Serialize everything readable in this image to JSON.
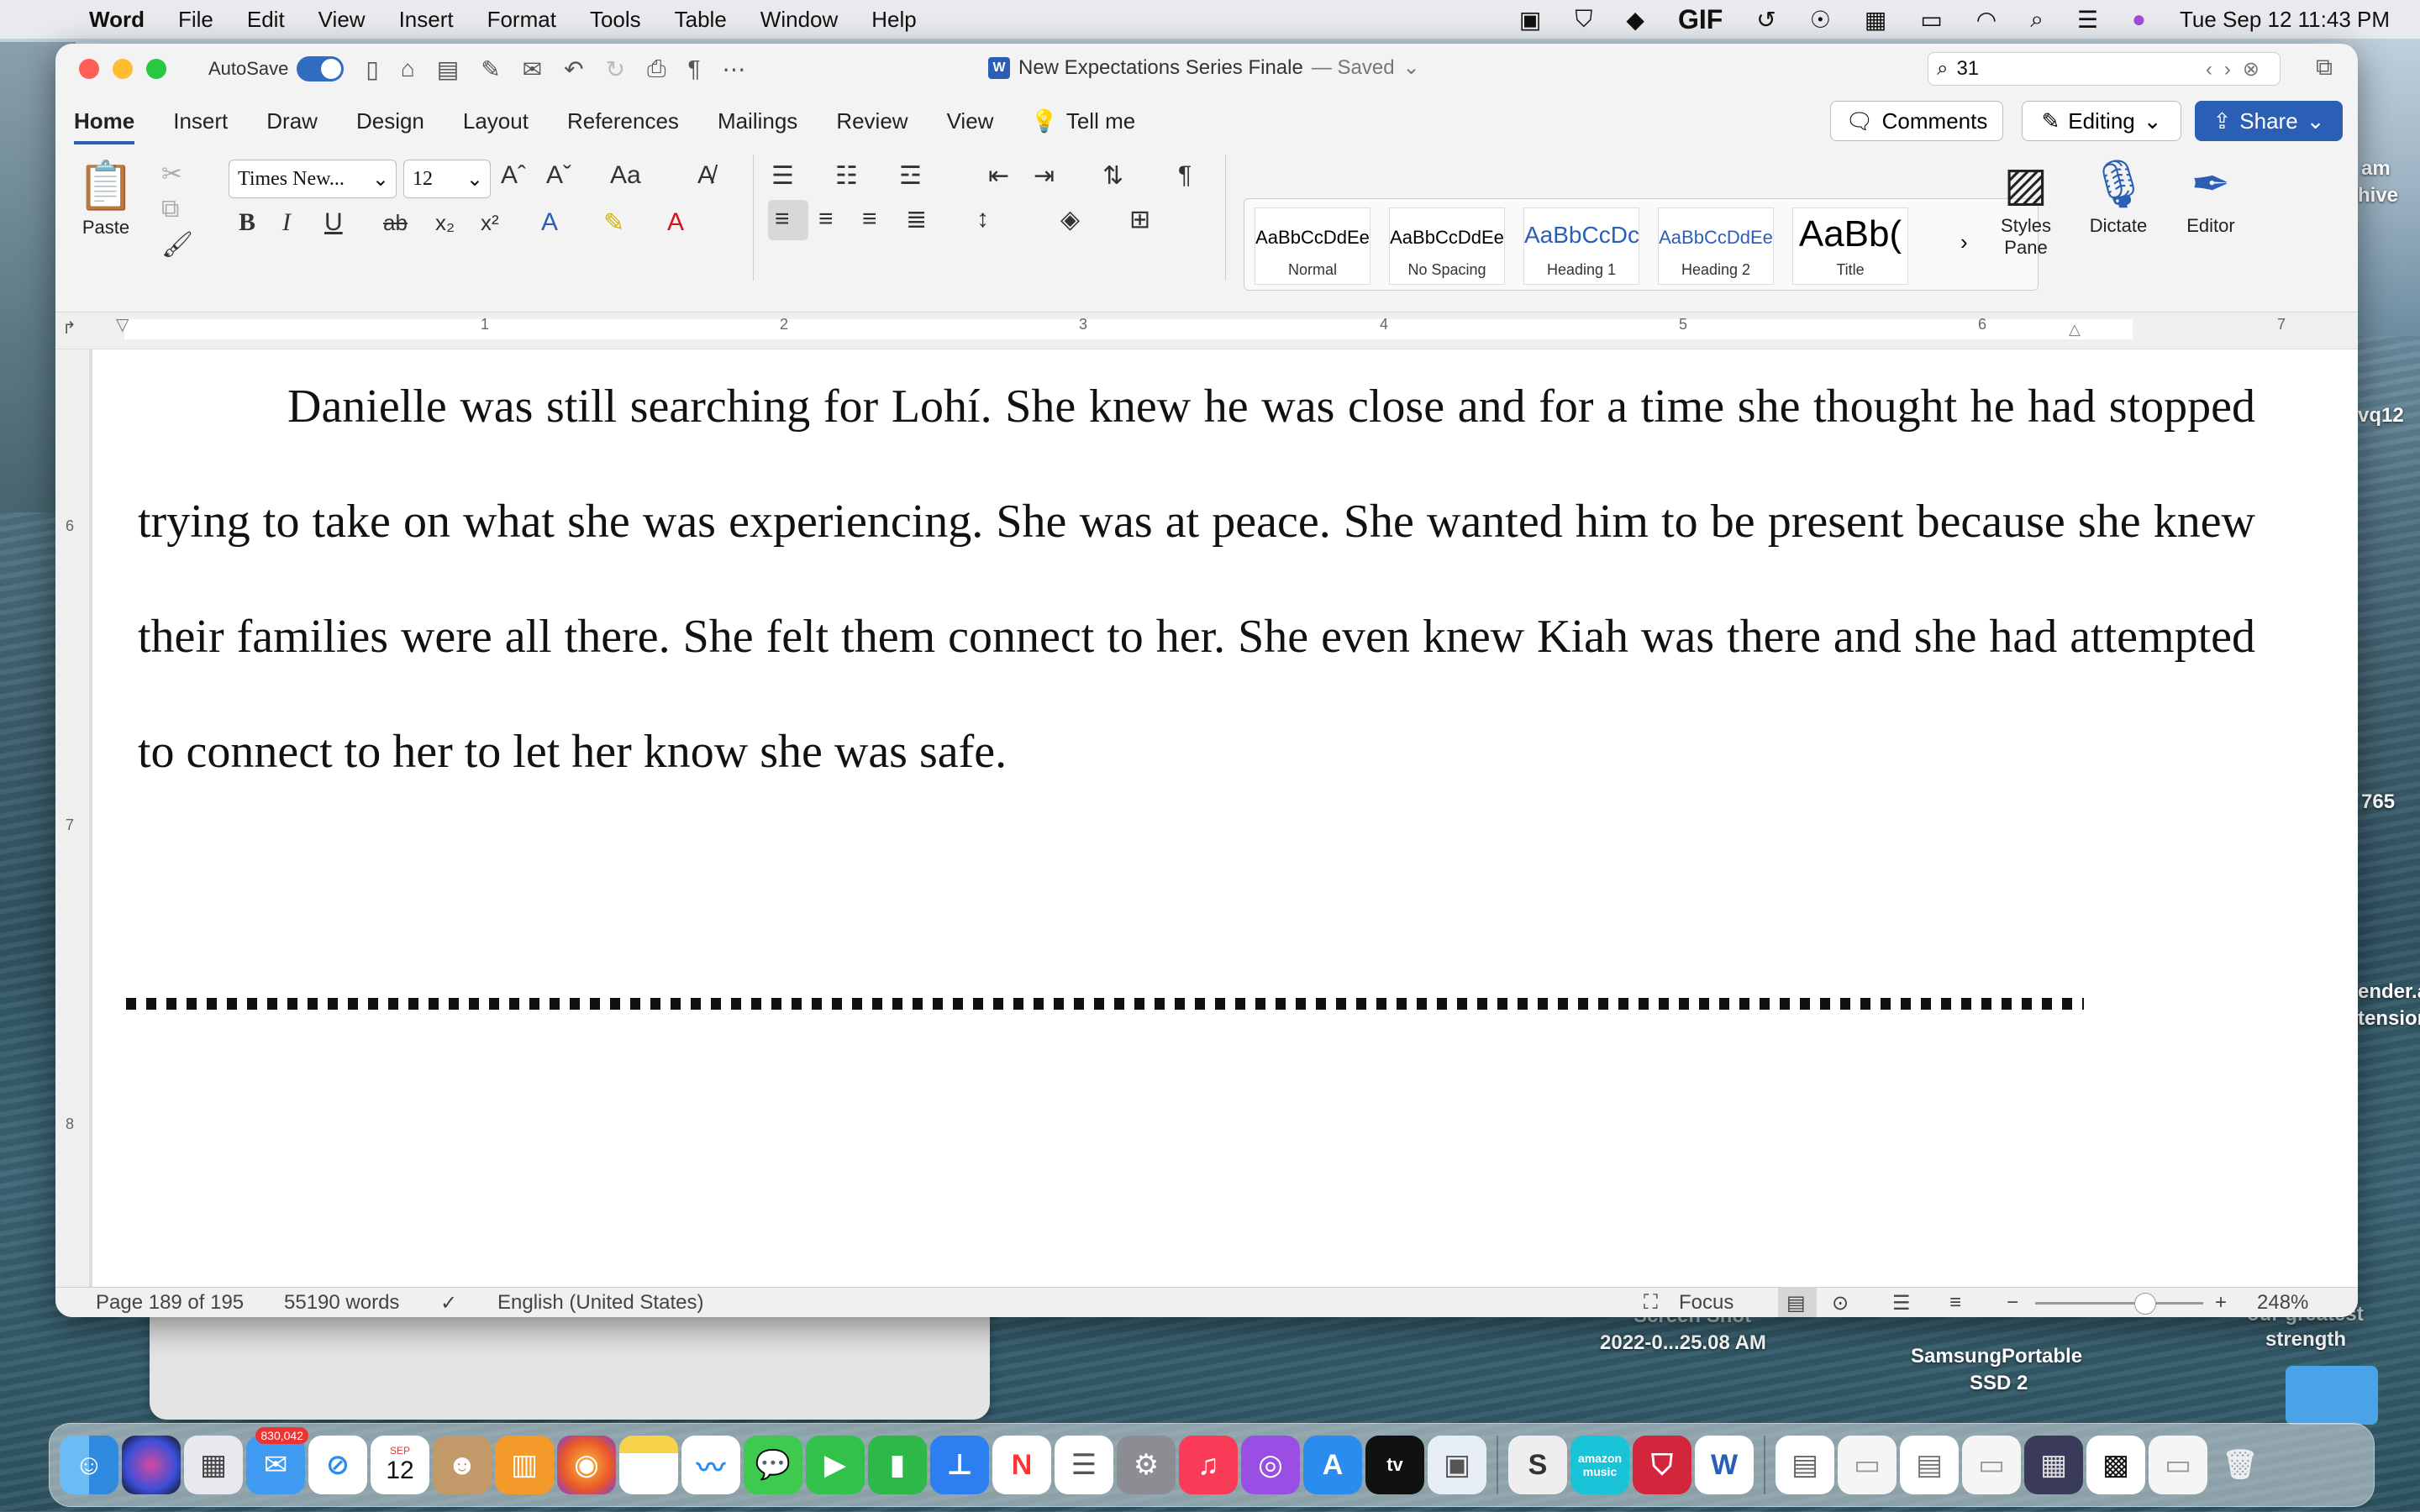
{
  "menubar": {
    "app": "Word",
    "items": [
      "File",
      "Edit",
      "View",
      "Insert",
      "Format",
      "Tools",
      "Table",
      "Window",
      "Help"
    ],
    "clock": "Tue Sep 12  11:43 PM",
    "gif_label": "GIF"
  },
  "desktop": {
    "labels": [
      "am",
      "hive",
      "vq12",
      "765",
      "ender.a",
      "tensior",
      "Screen Shot",
      "2022-0...25.08 AM",
      "SamsungPortable",
      "SSD 2",
      "our greatest",
      "strength"
    ]
  },
  "window": {
    "autosave_label": "AutoSave",
    "doc_title": "New Expectations Series Finale",
    "saved_status": "— Saved",
    "search_value": "31",
    "tabs": [
      "Home",
      "Insert",
      "Draw",
      "Design",
      "Layout",
      "References",
      "Mailings",
      "Review",
      "View"
    ],
    "tell_me": "Tell me",
    "comments": "Comments",
    "editing": "Editing",
    "share": "Share"
  },
  "ribbon": {
    "paste": "Paste",
    "font_name": "Times New...",
    "font_size": "12",
    "styles": [
      {
        "sample": "AaBbCcDdEe",
        "name": "Normal"
      },
      {
        "sample": "AaBbCcDdEe",
        "name": "No Spacing"
      },
      {
        "sample": "AaBbCcDc",
        "name": "Heading 1"
      },
      {
        "sample": "AaBbCcDdEe",
        "name": "Heading 2"
      },
      {
        "sample": "AaBb(",
        "name": "Title"
      }
    ],
    "styles_pane": "Styles Pane",
    "dictate": "Dictate",
    "editor": "Editor"
  },
  "ruler": {
    "numbers": [
      "1",
      "2",
      "3",
      "4",
      "5",
      "6",
      "7"
    ],
    "vnumbers": [
      "6",
      "7",
      "8"
    ]
  },
  "document": {
    "paragraph": "Danielle was still searching for Lohí. She knew he was close and for a time she thought he had stopped trying to take on what she was experiencing. She was at peace. She wanted him to be present because she knew their families were all there. She felt them connect to her. She even knew Kiah was there and she had attempted to connect to her to let her know she was safe."
  },
  "statusbar": {
    "page": "Page 189 of 195",
    "words": "55190 words",
    "language": "English (United States)",
    "focus": "Focus",
    "zoom": "248%"
  },
  "dock": {
    "mail_badge": "830,042",
    "calendar_month": "SEP",
    "calendar_day": "12",
    "amazon_music": "amazon music",
    "tv": "tv"
  },
  "colors": {
    "accent": "#2b5fb5",
    "close": "#ff5f57",
    "minimize": "#febc2e",
    "maximize": "#28c840"
  }
}
